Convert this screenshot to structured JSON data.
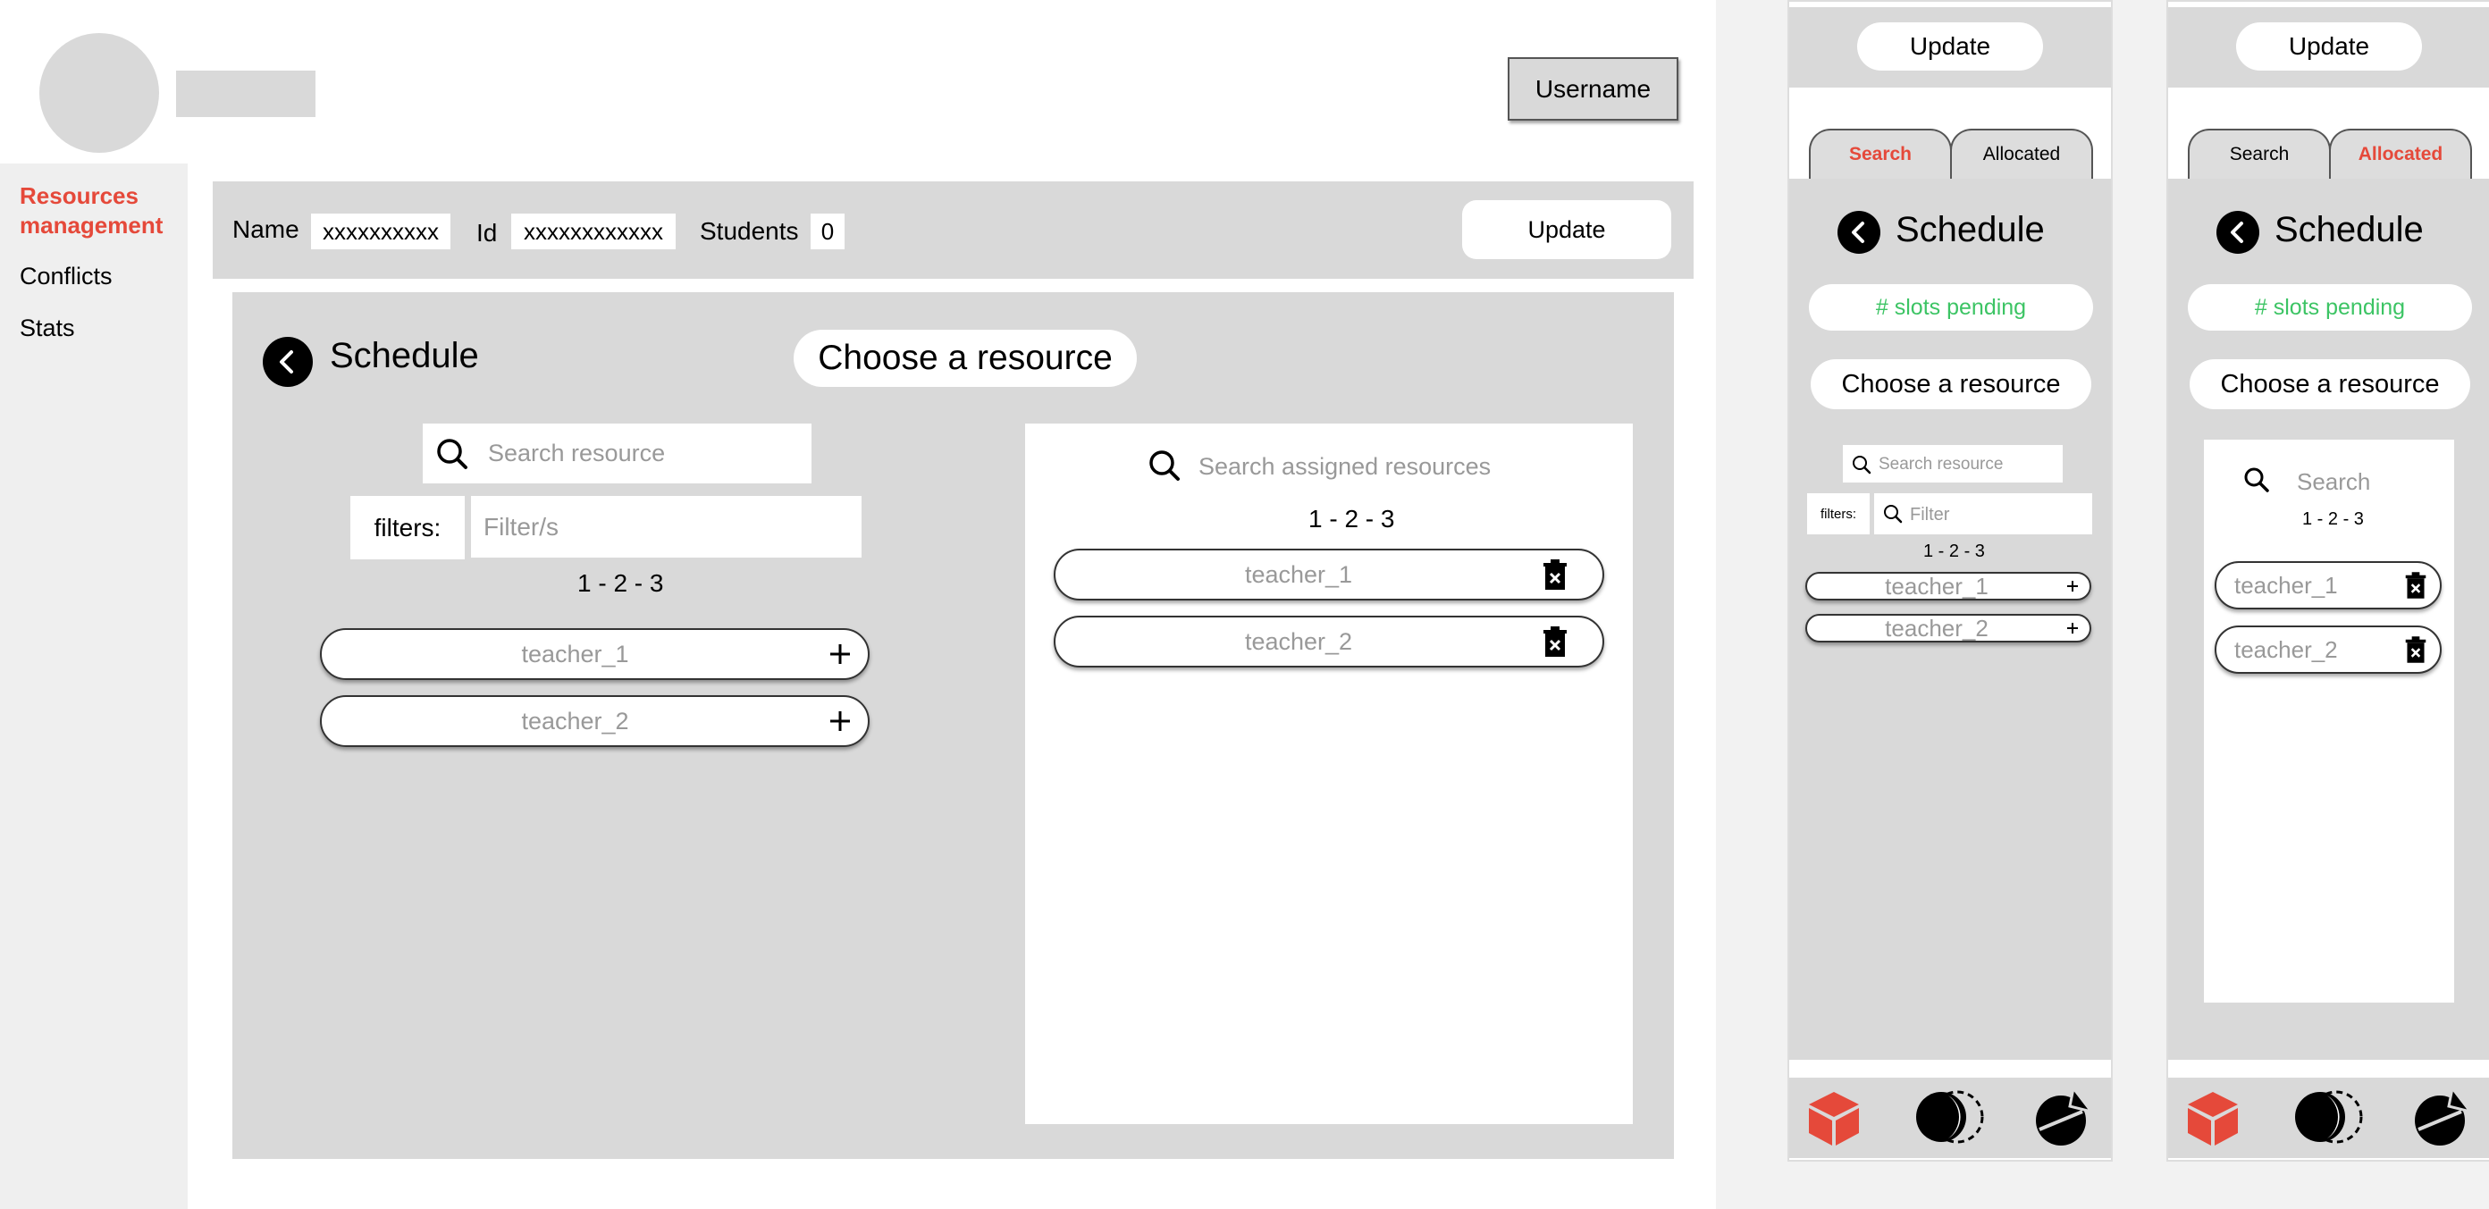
{
  "desktop": {
    "user_button": "Username",
    "sidebar": {
      "items": [
        {
          "label": "Resources management",
          "active": true
        },
        {
          "label": "Conflicts",
          "active": false
        },
        {
          "label": "Stats",
          "active": false
        }
      ]
    },
    "info_bar": {
      "name_label": "Name",
      "name_value": "xxxxxxxxxx",
      "id_label": "Id",
      "id_value": "xxxxxxxxxxxx",
      "students_label": "Students",
      "students_value": "0",
      "update_button": "Update"
    },
    "schedule": {
      "title": "Schedule",
      "choose_button": "Choose a resource",
      "search_placeholder": "Search resource",
      "filters_label": "filters:",
      "filters_placeholder": "Filter/s",
      "pagination": "1 - 2 - 3",
      "available": [
        "teacher_1",
        "teacher_2"
      ],
      "assigned_search_placeholder": "Search assigned resources",
      "assigned_pagination": "1 - 2 - 3",
      "assigned": [
        "teacher_1",
        "teacher_2"
      ]
    }
  },
  "mobile_search": {
    "update_button": "Update",
    "tabs": [
      {
        "label": "Search",
        "active": true
      },
      {
        "label": "Allocated",
        "active": false
      }
    ],
    "title": "Schedule",
    "slots_pending": "# slots pending",
    "choose_button": "Choose a resource",
    "search_placeholder": "Search resource",
    "filters_label": "filters:",
    "filter_placeholder": "Filter",
    "pagination": "1 - 2 - 3",
    "items": [
      "teacher_1",
      "teacher_2"
    ]
  },
  "mobile_allocated": {
    "update_button": "Update",
    "tabs": [
      {
        "label": "Search",
        "active": false
      },
      {
        "label": "Allocated",
        "active": true
      }
    ],
    "title": "Schedule",
    "slots_pending": "# slots pending",
    "choose_button": "Choose a resource",
    "search_placeholder": "Search",
    "pagination": "1 - 2 - 3",
    "items": [
      "teacher_1",
      "teacher_2"
    ]
  },
  "bottom_nav_icons": [
    "cube-icon",
    "moon-eclipse-icon",
    "pie-chart-icon"
  ],
  "colors": {
    "accent": "#e5493a",
    "pending_green": "#3cc464",
    "panel_gray": "#d9d9d9",
    "sidebar_gray": "#efefef"
  }
}
